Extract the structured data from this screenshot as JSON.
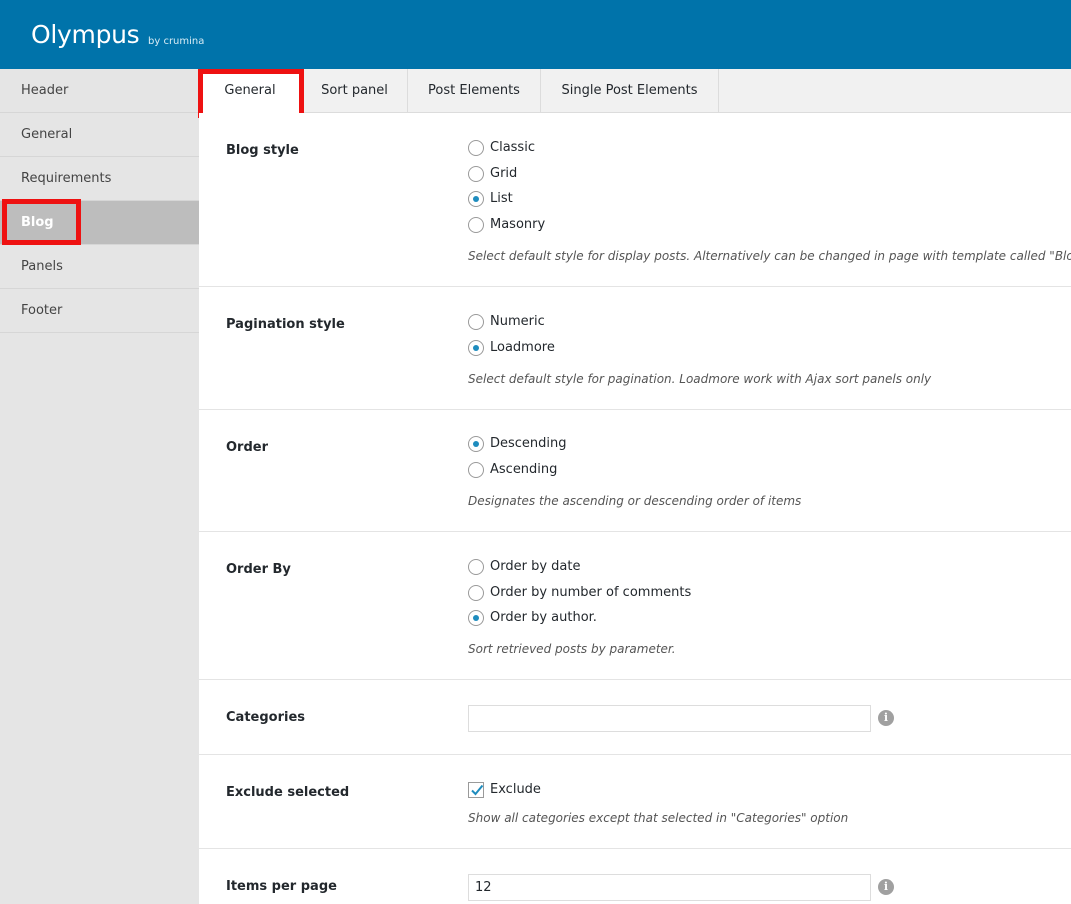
{
  "app": {
    "title": "Olympus",
    "by": "by crumina"
  },
  "sidebar": {
    "items": [
      {
        "label": "Header"
      },
      {
        "label": "General"
      },
      {
        "label": "Requirements"
      },
      {
        "label": "Blog"
      },
      {
        "label": "Panels"
      },
      {
        "label": "Footer"
      }
    ],
    "active": "Blog"
  },
  "tabs": [
    {
      "label": "General"
    },
    {
      "label": "Sort panel"
    },
    {
      "label": "Post Elements"
    },
    {
      "label": "Single Post Elements"
    }
  ],
  "active_tab": "General",
  "sections": {
    "blog_style": {
      "label": "Blog style",
      "options": [
        "Classic",
        "Grid",
        "List",
        "Masonry"
      ],
      "selected": "List",
      "description": "Select default style for display posts. Alternatively can be changed in page with template called \"Blog page\""
    },
    "pagination_style": {
      "label": "Pagination style",
      "options": [
        "Numeric",
        "Loadmore"
      ],
      "selected": "Loadmore",
      "description": "Select default style for pagination. Loadmore work with Ajax sort panels only"
    },
    "order": {
      "label": "Order",
      "options": [
        "Descending",
        "Ascending"
      ],
      "selected": "Descending",
      "description": "Designates the ascending or descending order of items"
    },
    "order_by": {
      "label": "Order By",
      "options": [
        "Order by date",
        "Order by number of comments",
        "Order by author."
      ],
      "selected": "Order by author.",
      "description": "Sort retrieved posts by parameter."
    },
    "categories": {
      "label": "Categories",
      "value": ""
    },
    "exclude_selected": {
      "label": "Exclude selected",
      "checkbox_label": "Exclude",
      "checked": true,
      "description": "Show all categories except that selected in \"Categories\" option"
    },
    "items_per_page": {
      "label": "Items per page",
      "value": "12"
    }
  },
  "icons": {
    "info": "info-icon",
    "check": "checkmark-icon"
  },
  "colors": {
    "topbar": "#0073aa",
    "highlight": "#ee1111",
    "radio_dot": "#1e8cbe"
  }
}
